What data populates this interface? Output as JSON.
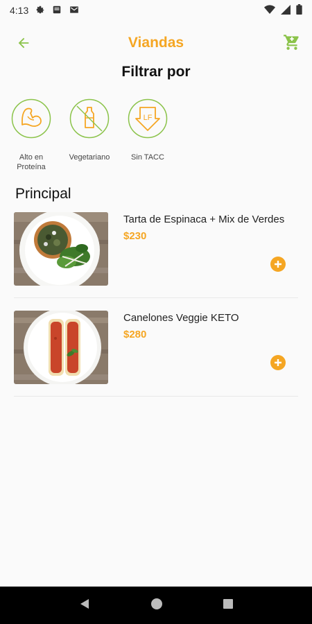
{
  "status_bar": {
    "time": "4:13"
  },
  "header": {
    "title": "Viandas"
  },
  "filters_title": "Filtrar por",
  "filters": [
    {
      "label": "Alto en Proteína",
      "icon": "bicep-icon"
    },
    {
      "label": "Vegetariano",
      "icon": "no-milk-icon"
    },
    {
      "label": "Sin TACC",
      "icon": "gluten-free-icon",
      "badge": "LF"
    }
  ],
  "section": {
    "title": "Principal"
  },
  "items": [
    {
      "name": "Tarta de Espinaca + Mix de Verdes",
      "price": "$230"
    },
    {
      "name": "Canelones Veggie KETO",
      "price": "$280"
    }
  ],
  "colors": {
    "accent": "#f5a623",
    "green": "#8bc34a",
    "icon_ring": "#8bc34a",
    "icon_orange": "#f5a623"
  }
}
